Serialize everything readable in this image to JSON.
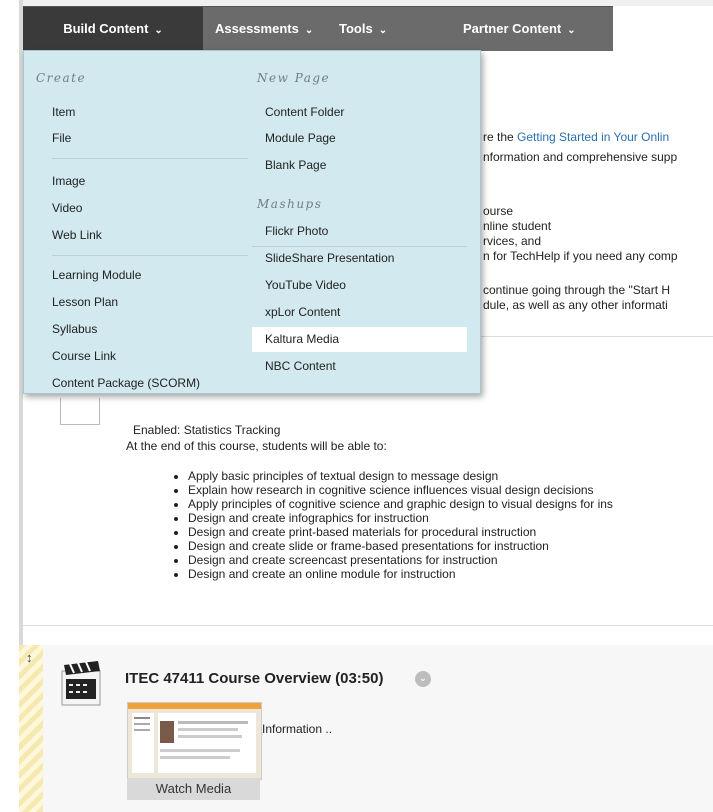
{
  "menubar": {
    "tabs": [
      {
        "label": "Build Content"
      },
      {
        "label": "Assessments"
      },
      {
        "label": "Tools"
      },
      {
        "label": "Partner Content"
      }
    ]
  },
  "dropdown": {
    "create_heading": "Create",
    "new_page_heading": "New Page",
    "mashups_heading": "Mashups",
    "create_items": [
      "Item",
      "File",
      "Image",
      "Video",
      "Web Link",
      "Learning Module",
      "Lesson Plan",
      "Syllabus",
      "Course Link",
      "Content Package (SCORM)"
    ],
    "new_page_items": [
      "Content Folder",
      "Module Page",
      "Blank Page"
    ],
    "mashup_items": [
      "Flickr Photo",
      "SlideShare Presentation",
      "YouTube Video",
      "xpLor Content",
      "Kaltura Media",
      "NBC Content"
    ],
    "highlighted": "Kaltura Media"
  },
  "background": {
    "line1_prefix": "re the ",
    "line1_link": "Getting Started in Your Onlin",
    "line2": "nformation and comprehensive supp",
    "line3": "ourse",
    "line4": "nline student",
    "line5": "rvices, and",
    "line6": "n for TechHelp if you need any comp",
    "line7": "continue going through the \"Start H",
    "line8": "dule, as well as any other informati"
  },
  "objectives": {
    "enabled": "Enabled:  Statistics Tracking",
    "intro": "At the end of this course, students will be able to:",
    "bullets": [
      "Apply basic principles of textual design to message design",
      "Explain how research in cognitive science influences visual design decisions",
      "Apply principles of cognitive science and graphic design to visual designs for ins",
      "Design and create infographics for instruction",
      "Design and create print-based materials for procedural instruction",
      "Design and create slide or frame-based presentations for instruction",
      "Design and create screencast presentations for instruction",
      "Design and create an online module for instruction"
    ]
  },
  "media_item": {
    "title": "ITEC 47411 Course Overview (03:50)",
    "info": "Information ..",
    "watch_label": "Watch Media",
    "drag_glyph": "↕"
  }
}
